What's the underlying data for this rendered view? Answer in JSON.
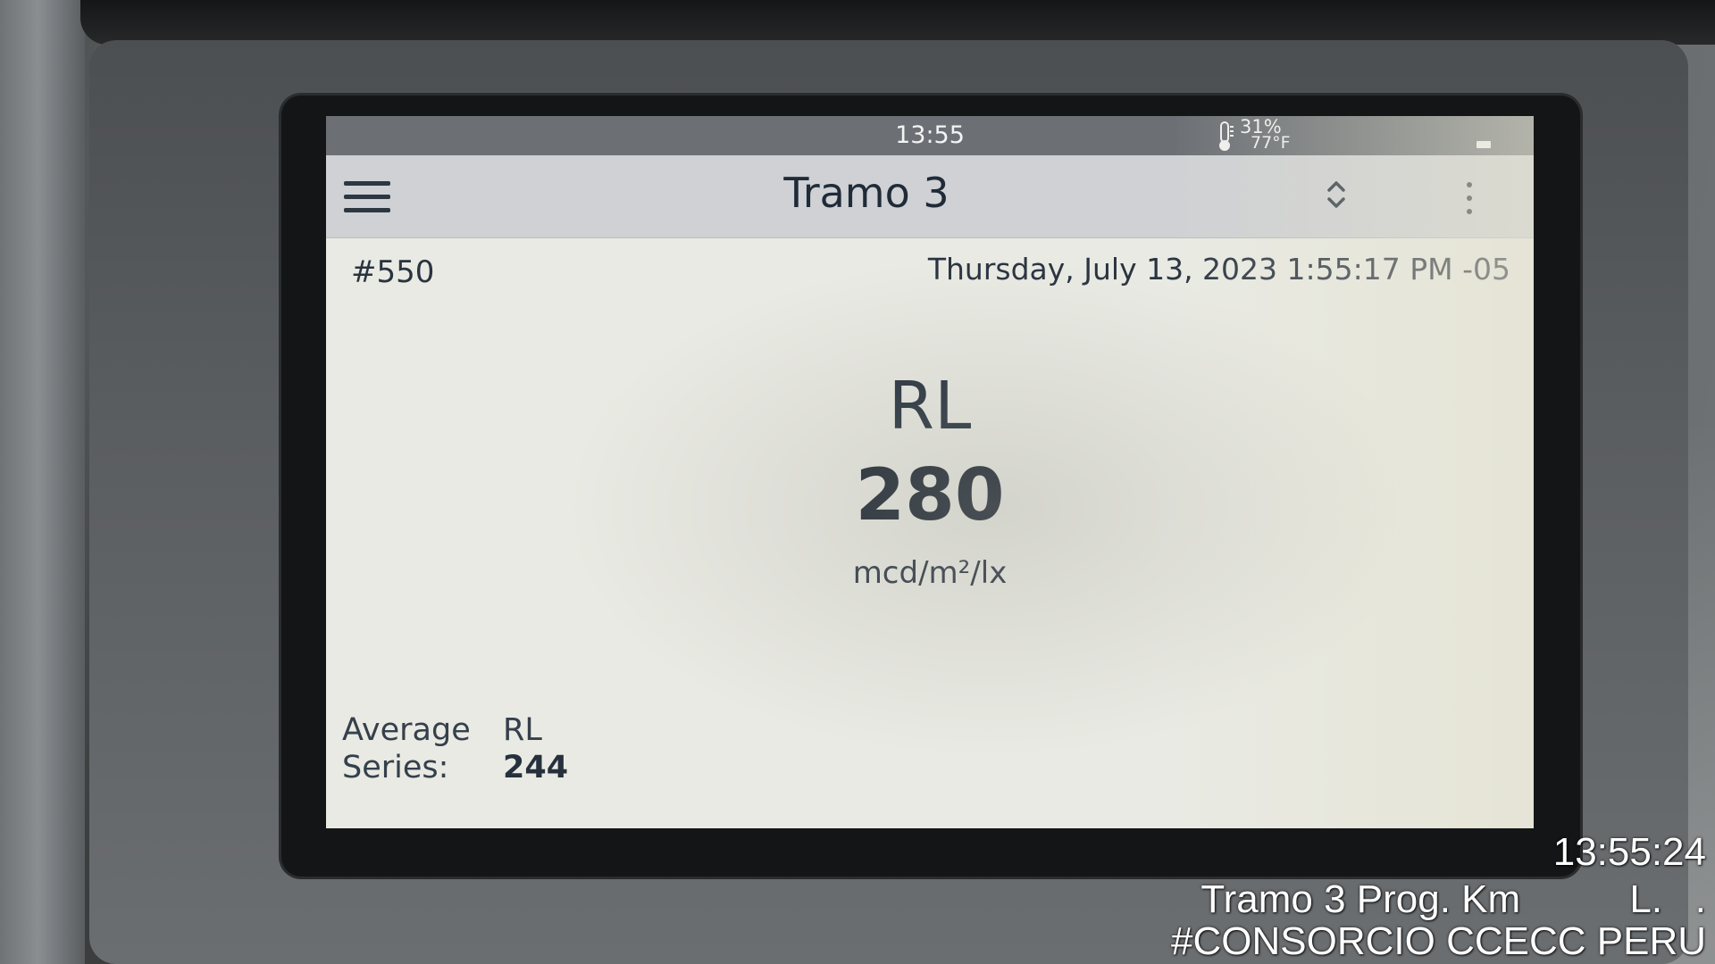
{
  "status_bar": {
    "time": "13:55",
    "humidity": "31%",
    "temperature": "77°F",
    "thermometer_icon": "thermometer-icon",
    "battery_icon": "battery-icon"
  },
  "app_bar": {
    "menu_icon": "hamburger-menu-icon",
    "title": "Tramo 3",
    "sort_icon": "sort-up-down-icon",
    "overflow_icon": "more-vertical-icon"
  },
  "record": {
    "number": "#550",
    "datetime": "Thursday, July 13, 2023 1:55:17 PM -05"
  },
  "measurement": {
    "label": "RL",
    "value": "280",
    "unit": "mcd/m²/lx"
  },
  "average": {
    "line1": "Average",
    "line2": "Series:",
    "column_header": "RL",
    "value": "244"
  },
  "photo_stamp": {
    "time": "13:55:24",
    "location": "Tramo 3 Prog. Km          L.   .",
    "company": "#CONSORCIO CCECC PERU"
  },
  "colors": {
    "status_bar": "#6c7075",
    "app_bar": "#cfd1d4",
    "screen": "#e9eae3",
    "text_dark": "#1f2b38"
  }
}
